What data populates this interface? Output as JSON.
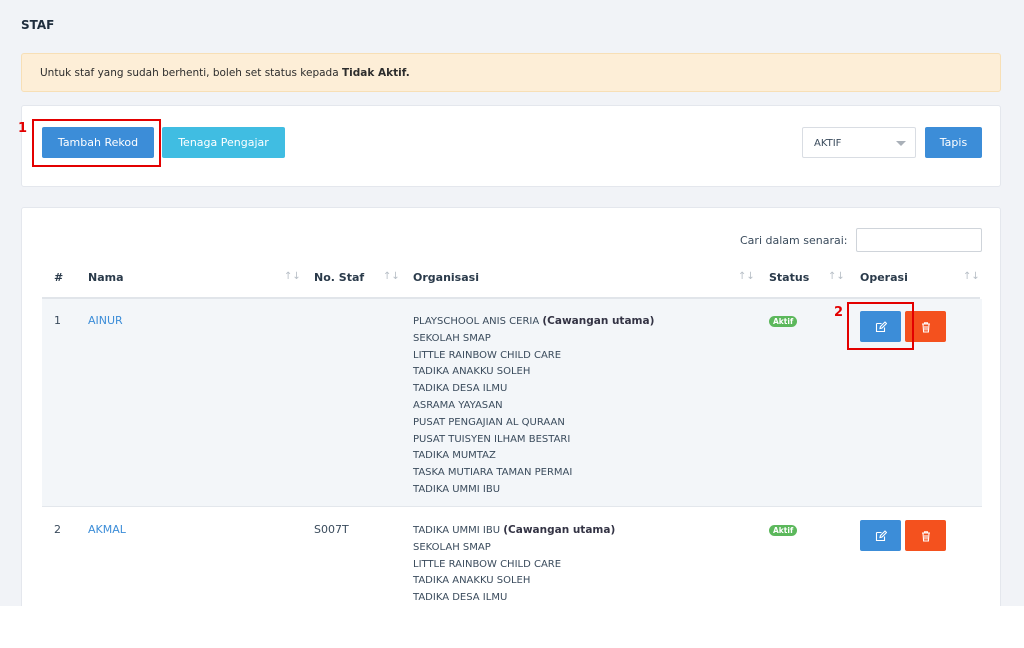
{
  "page": {
    "title": "STAF"
  },
  "alert": {
    "text": "Untuk staf yang sudah berhenti, boleh set status kepada ",
    "bold": "Tidak Aktif."
  },
  "toolbar": {
    "add_label": "Tambah Rekod",
    "teacher_label": "Tenaga Pengajar",
    "status_filter": "AKTIF",
    "filter_label": "Tapis"
  },
  "annotations": {
    "first": "1",
    "second": "2"
  },
  "search": {
    "label": "Cari dalam senarai:",
    "value": ""
  },
  "table": {
    "columns": [
      "#",
      "Nama",
      "No. Staf",
      "Organisasi",
      "Status",
      "Operasi"
    ],
    "rows": [
      {
        "index": "1",
        "name": "AINUR",
        "staff_no": "",
        "main_org": "PLAYSCHOOL ANIS CERIA",
        "main_tag": "(Cawangan utama)",
        "orgs": [
          "SEKOLAH SMAP",
          "LITTLE RAINBOW CHILD CARE",
          "TADIKA ANAKKU SOLEH",
          "TADIKA DESA ILMU",
          "ASRAMA YAYASAN",
          "PUSAT PENGAJIAN AL QURAAN",
          "PUSAT TUISYEN ILHAM BESTARI",
          "TADIKA MUMTAZ",
          "TASKA MUTIARA TAMAN PERMAI",
          "TADIKA UMMI IBU"
        ],
        "status": "Aktif"
      },
      {
        "index": "2",
        "name": "AKMAL",
        "staff_no": "S007T",
        "main_org": "TADIKA UMMI IBU",
        "main_tag": "(Cawangan utama)",
        "orgs": [
          "SEKOLAH SMAP",
          "LITTLE RAINBOW CHILD CARE",
          "TADIKA ANAKKU SOLEH",
          "TADIKA DESA ILMU"
        ],
        "status": "Aktif"
      }
    ]
  },
  "colors": {
    "primary": "#3c8dd8",
    "info": "#40bde2",
    "danger": "#f4511e",
    "success": "#5cb85c",
    "highlight": "#e30000"
  }
}
